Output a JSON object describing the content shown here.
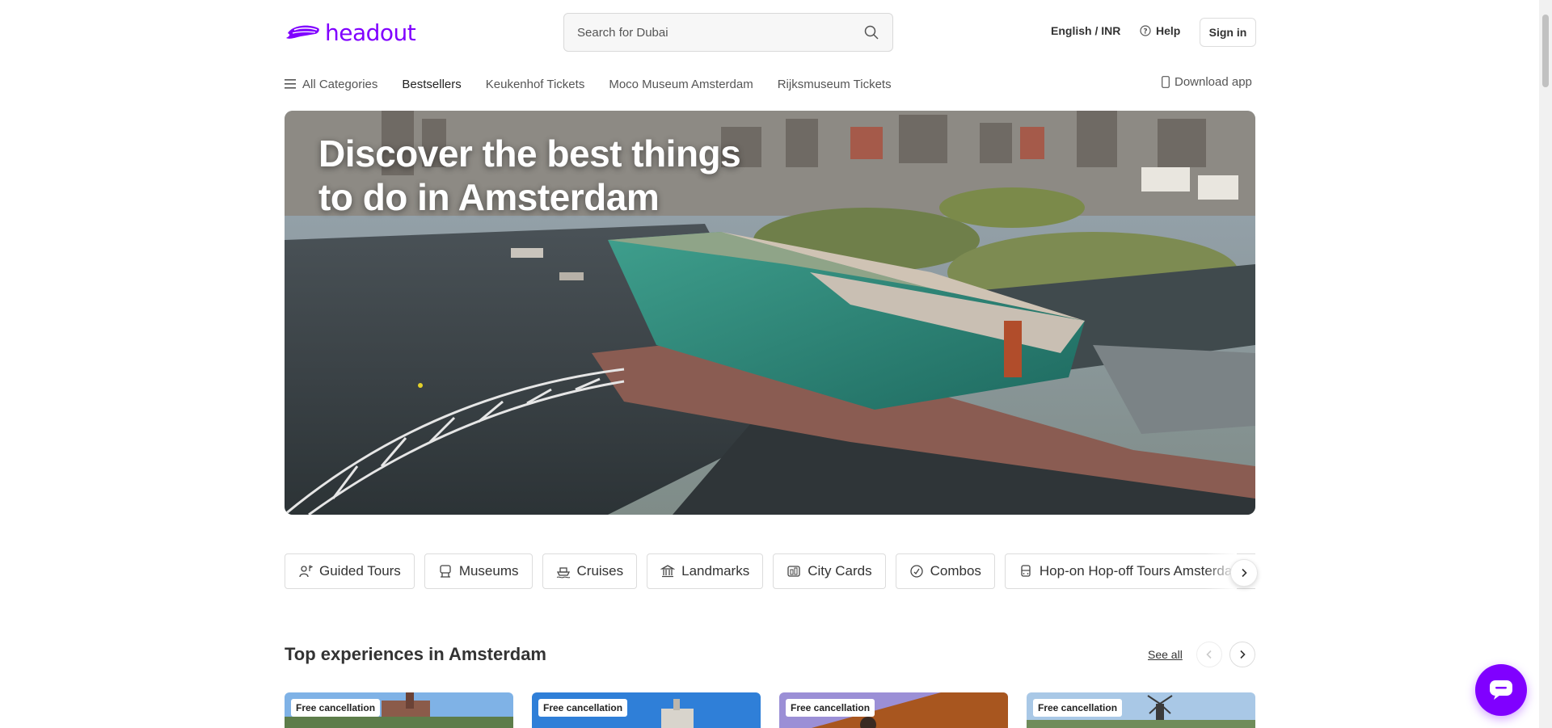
{
  "brand": {
    "name": "headout",
    "color": "#8000ff"
  },
  "header": {
    "search_placeholder": "Search for Dubai",
    "language": "English / INR",
    "help": "Help",
    "sign_in": "Sign in"
  },
  "nav": {
    "all_categories": "All Categories",
    "items": [
      "Bestsellers",
      "Keukenhof Tickets",
      "Moco Museum Amsterdam",
      "Rijksmuseum Tickets"
    ],
    "download_app": "Download app"
  },
  "hero": {
    "title": "Discover the best things to do in Amsterdam"
  },
  "categories": [
    {
      "label": "Guided Tours",
      "icon": "guide-icon"
    },
    {
      "label": "Museums",
      "icon": "museum-icon"
    },
    {
      "label": "Cruises",
      "icon": "ship-icon"
    },
    {
      "label": "Landmarks",
      "icon": "landmark-icon"
    },
    {
      "label": "City Cards",
      "icon": "city-card-icon"
    },
    {
      "label": "Combos",
      "icon": "combo-icon"
    },
    {
      "label": "Hop-on Hop-off Tours Amsterdam",
      "icon": "bus-icon"
    }
  ],
  "top_experiences": {
    "title": "Top experiences in Amsterdam",
    "see_all": "See all",
    "cards": [
      {
        "badge": "Free cancellation"
      },
      {
        "badge": "Free cancellation"
      },
      {
        "badge": "Free cancellation"
      },
      {
        "badge": "Free cancellation"
      }
    ]
  }
}
